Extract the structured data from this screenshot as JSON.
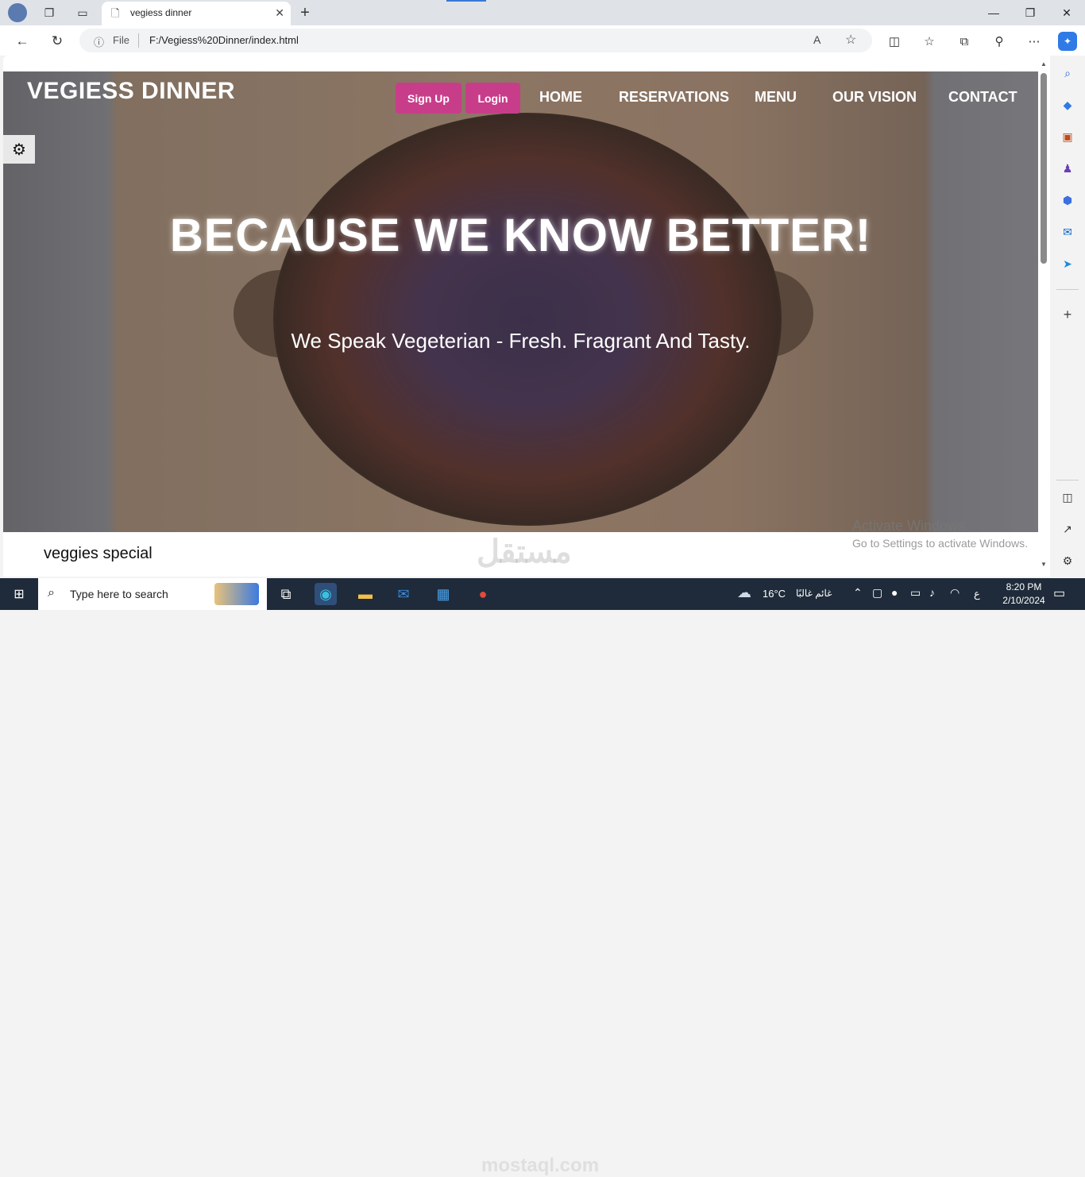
{
  "browser": {
    "tab_title": "vegiess dinner",
    "tab_close": "✕",
    "new_tab": "+",
    "address": {
      "info_icon": "ⓘ",
      "scheme_label": "File",
      "url": "F:/Vegiess%20Dinner/index.html"
    },
    "window_controls": {
      "minimize": "—",
      "maximize": "❐",
      "close": "✕"
    }
  },
  "site": {
    "brand": "VEGIESS DINNER",
    "buttons": {
      "signup": "Sign Up",
      "login": "Login"
    },
    "nav": [
      "HOME",
      "RESERVATIONS",
      "MENU",
      "OUR VISION",
      "CONTACT"
    ],
    "hero": {
      "headline": "BECAUSE WE KNOW BETTER!",
      "subline": "We Speak Vegeterian - Fresh. Fragrant And Tasty."
    },
    "section_title": "veggies special",
    "accent_color": "#c83d8a"
  },
  "overlay": {
    "activate_title": "Activate Windows",
    "activate_sub": "Go to Settings to activate Windows.",
    "watermark": "مستقل",
    "watermark_domain": "mostaql.com"
  },
  "taskbar": {
    "search_placeholder": "Type here to search",
    "weather_temp": "16°C",
    "weather_desc": "غائم غالبًا",
    "language": "ع",
    "time": "8:20 PM",
    "date": "2/10/2024"
  }
}
